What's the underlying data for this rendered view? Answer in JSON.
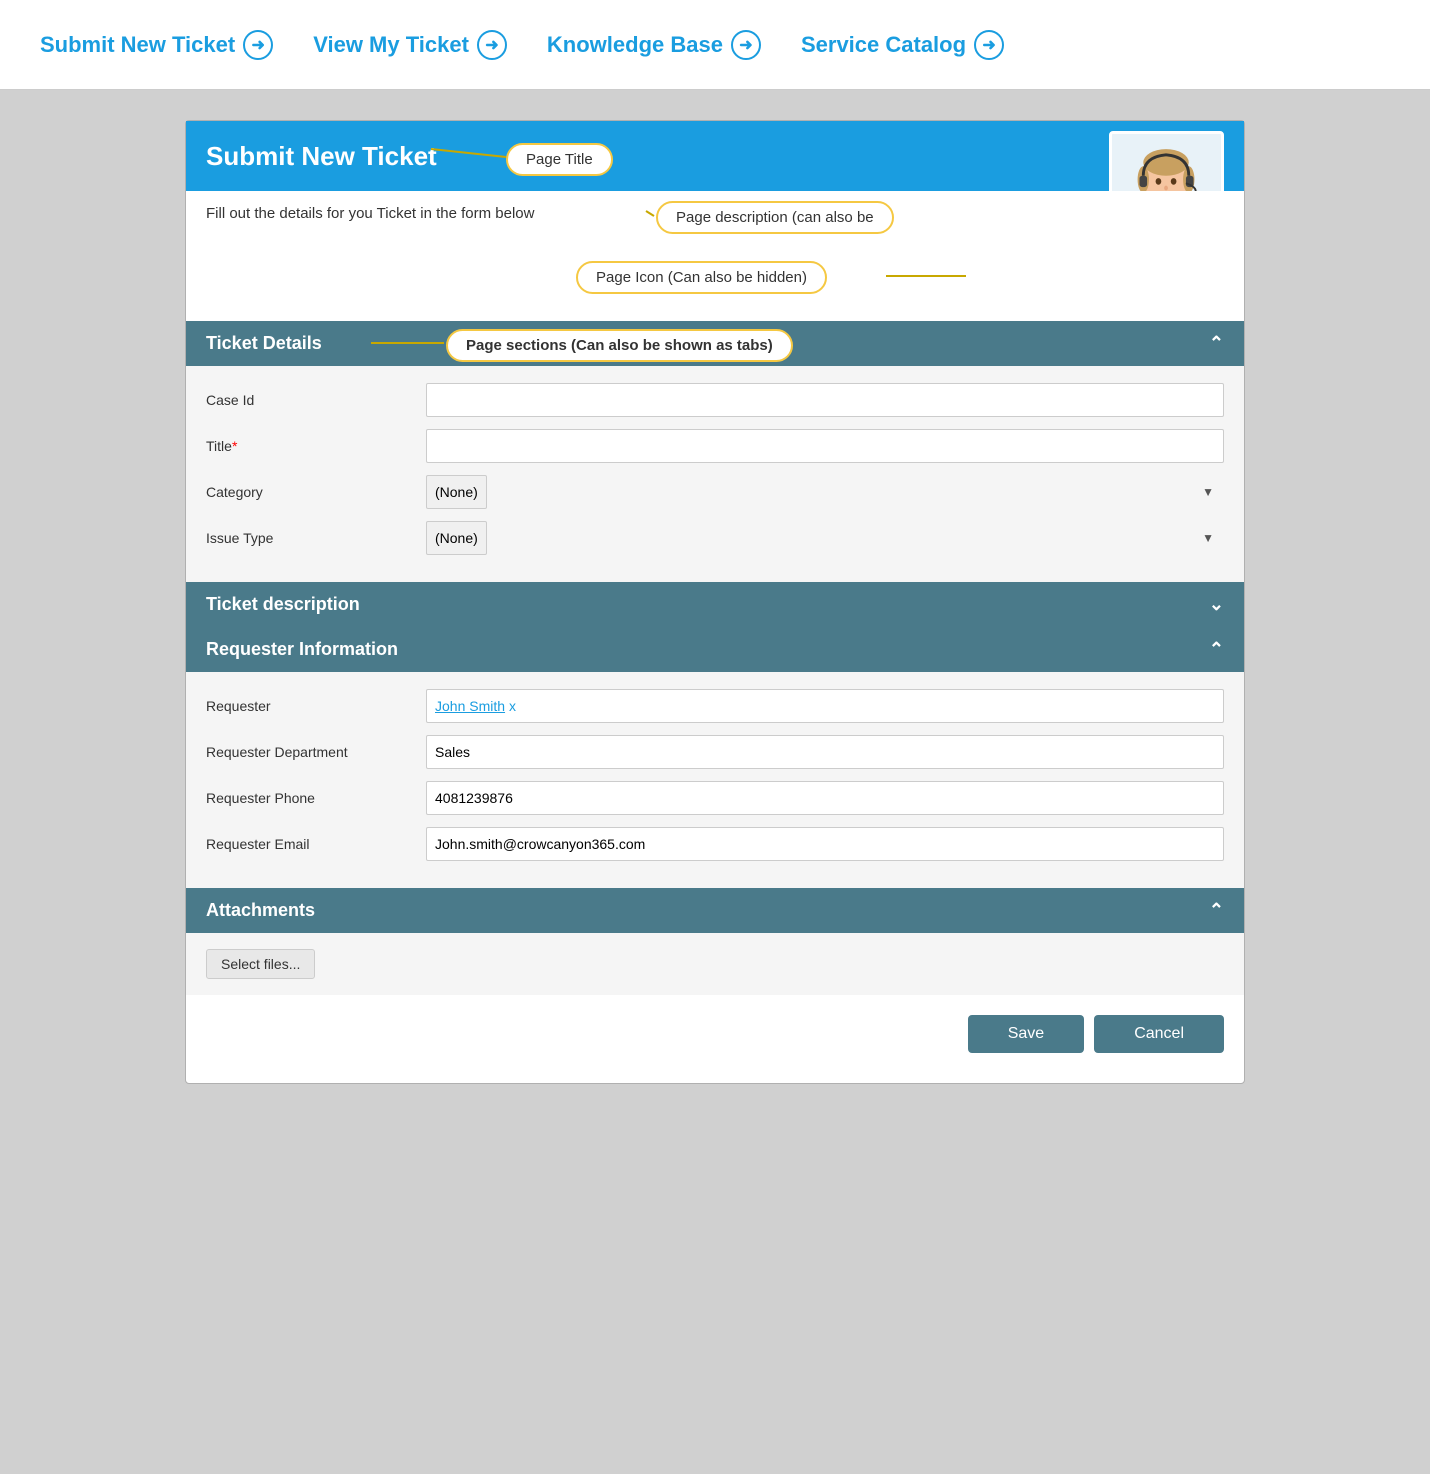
{
  "nav": {
    "items": [
      {
        "label": "Submit New Ticket",
        "name": "submit-new-ticket"
      },
      {
        "label": "View My Ticket",
        "name": "view-my-ticket"
      },
      {
        "label": "Knowledge Base",
        "name": "knowledge-base"
      },
      {
        "label": "Service Catalog",
        "name": "service-catalog"
      }
    ]
  },
  "page": {
    "header_title": "Submit New Ticket",
    "description": "Fill out the details for you Ticket in the form below",
    "tooltips": {
      "page_title": "Page Title",
      "page_description": "Page description (can also be",
      "page_icon": "Page Icon (Can also be hidden)"
    }
  },
  "sections": {
    "ticket_details": {
      "label": "Ticket Details",
      "tooltip": "Page sections (Can also be shown as tabs)",
      "fields": {
        "case_id": {
          "label": "Case Id",
          "value": "",
          "placeholder": ""
        },
        "title": {
          "label": "Title",
          "required": true,
          "value": "",
          "placeholder": ""
        },
        "category": {
          "label": "Category",
          "value": "(None)",
          "options": [
            "(None)"
          ]
        },
        "issue_type": {
          "label": "Issue Type",
          "value": "(None)",
          "options": [
            "(None)"
          ]
        }
      }
    },
    "ticket_description": {
      "label": "Ticket description"
    },
    "requester_information": {
      "label": "Requester Information",
      "fields": {
        "requester": {
          "label": "Requester",
          "value": "John Smith",
          "x": "x"
        },
        "requester_department": {
          "label": "Requester Department",
          "value": "Sales"
        },
        "requester_phone": {
          "label": "Requester Phone",
          "value": "4081239876"
        },
        "requester_email": {
          "label": "Requester Email",
          "value": "John.smith@crowcanyon365.com"
        }
      }
    },
    "attachments": {
      "label": "Attachments",
      "select_files_label": "Select files..."
    }
  },
  "buttons": {
    "save": "Save",
    "cancel": "Cancel"
  }
}
